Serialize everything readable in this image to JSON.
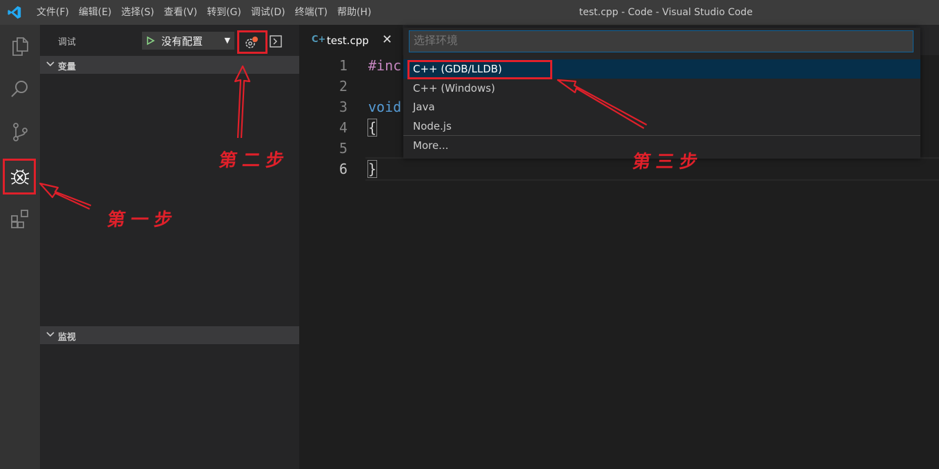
{
  "titlebar": {
    "menu": [
      "文件(F)",
      "编辑(E)",
      "选择(S)",
      "查看(V)",
      "转到(G)",
      "调试(D)",
      "终端(T)",
      "帮助(H)"
    ],
    "window_title": "test.cpp - Code - Visual Studio Code"
  },
  "activity_bar": {
    "icons": [
      "files-icon",
      "search-icon",
      "source-control-icon",
      "debug-icon",
      "extensions-icon"
    ],
    "active": "debug-icon"
  },
  "sidebar": {
    "title": "调试",
    "config_select": "没有配置",
    "sections": [
      {
        "label": "变量"
      },
      {
        "label": "监视"
      }
    ]
  },
  "editor": {
    "tab": {
      "name": "test.cpp"
    },
    "line_numbers": [
      "1",
      "2",
      "3",
      "4",
      "5",
      "6"
    ],
    "active_line": "6",
    "lines": [
      "#inc",
      "",
      "void",
      "{",
      "",
      "}"
    ]
  },
  "quick_pick": {
    "placeholder": "选择环境",
    "items": [
      "C++ (GDB/LLDB)",
      "C++ (Windows)",
      "Java",
      "Node.js",
      "More..."
    ],
    "selected": "C++ (GDB/LLDB)"
  },
  "annotations": {
    "step1": "第一步",
    "step2": "第二步",
    "step3": "第三步"
  },
  "colors": {
    "accent": "#007acc",
    "annotation_red": "#e0202a",
    "selection_bg": "#062f4a"
  }
}
